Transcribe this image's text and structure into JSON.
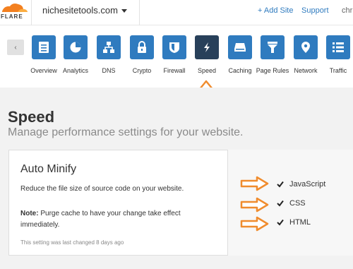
{
  "header": {
    "logo_text": "FLARE",
    "site": "nichesitetools.com",
    "add_site": "+ Add Site",
    "support": "Support",
    "user": "chr"
  },
  "nav": {
    "items": [
      {
        "label": "Overview",
        "icon": "overview-icon"
      },
      {
        "label": "Analytics",
        "icon": "analytics-icon"
      },
      {
        "label": "DNS",
        "icon": "dns-icon"
      },
      {
        "label": "Crypto",
        "icon": "lock-icon"
      },
      {
        "label": "Firewall",
        "icon": "shield-icon"
      },
      {
        "label": "Speed",
        "icon": "lightning-icon",
        "active": true
      },
      {
        "label": "Caching",
        "icon": "drive-icon"
      },
      {
        "label": "Page Rules",
        "icon": "filter-icon"
      },
      {
        "label": "Network",
        "icon": "location-icon"
      },
      {
        "label": "Traffic",
        "icon": "list-icon"
      }
    ],
    "accent": "#2f7bbf",
    "active_color": "#28405a"
  },
  "page": {
    "title": "Speed",
    "subtitle": "Manage performance settings for your website."
  },
  "card": {
    "title": "Auto Minify",
    "description": "Reduce the file size of source code on your website.",
    "note_label": "Note:",
    "note_text": " Purge cache to have your change take effect immediately.",
    "meta": "This setting was last changed 8 days ago",
    "options": [
      {
        "label": "JavaScript",
        "checked": true
      },
      {
        "label": "CSS",
        "checked": true
      },
      {
        "label": "HTML",
        "checked": true
      }
    ]
  },
  "annotation_color": "#f08c2e"
}
